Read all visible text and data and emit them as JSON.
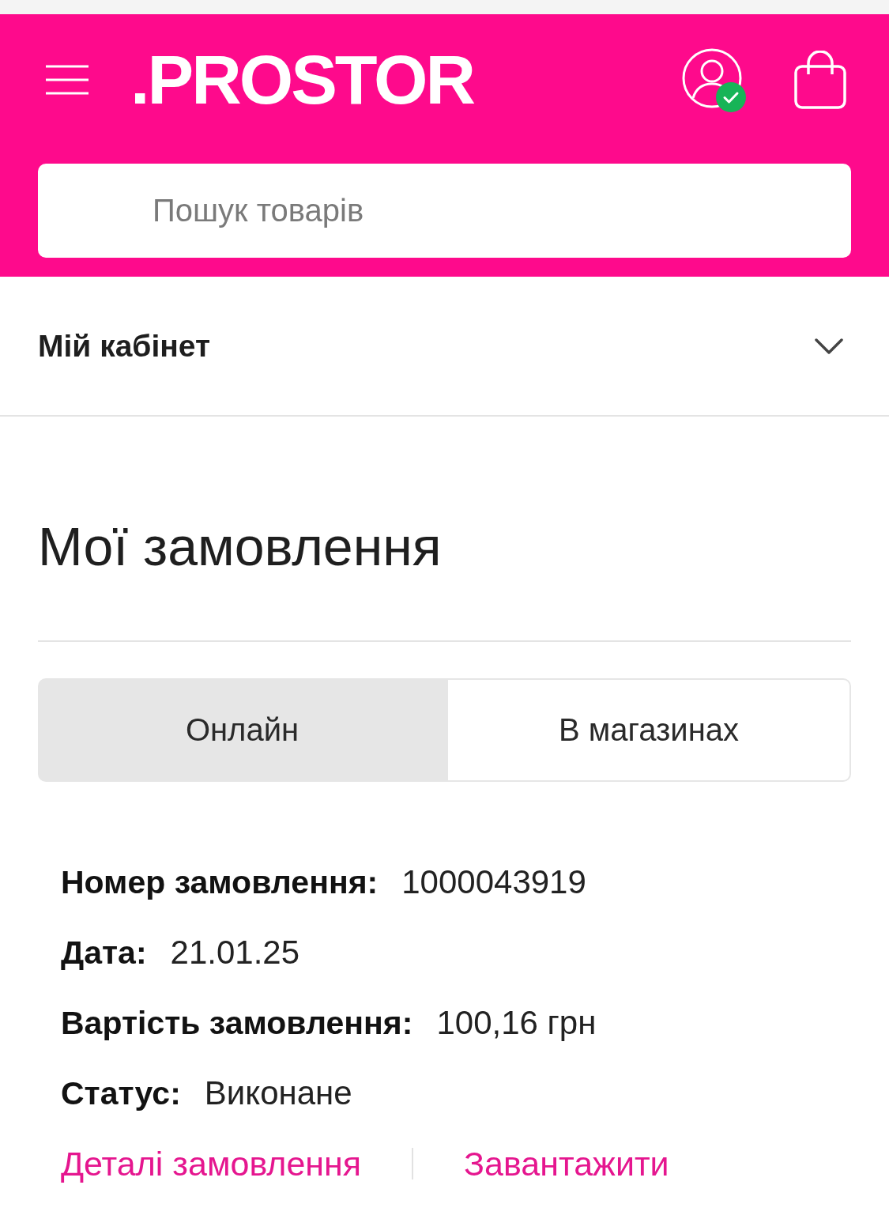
{
  "header": {
    "logo": ".PROSTOR",
    "account_verified": true,
    "search": {
      "placeholder": "Пошук товарів"
    }
  },
  "account_menu": {
    "title": "Мій кабінет",
    "expanded": false
  },
  "page_title": "Мої замовлення",
  "tabs": [
    {
      "label": "Онлайн",
      "selected": true
    },
    {
      "label": "В магазинах",
      "selected": false
    }
  ],
  "order": {
    "fields": [
      {
        "label": "Номер замовлення:",
        "value": "1000043919"
      },
      {
        "label": "Дата:",
        "value": "21.01.25"
      },
      {
        "label": "Вартість замовлення:",
        "value": "100,16 грн"
      },
      {
        "label": "Статус:",
        "value": "Виконане"
      }
    ],
    "links": [
      "Деталі замовлення",
      "Завантажити"
    ]
  }
}
